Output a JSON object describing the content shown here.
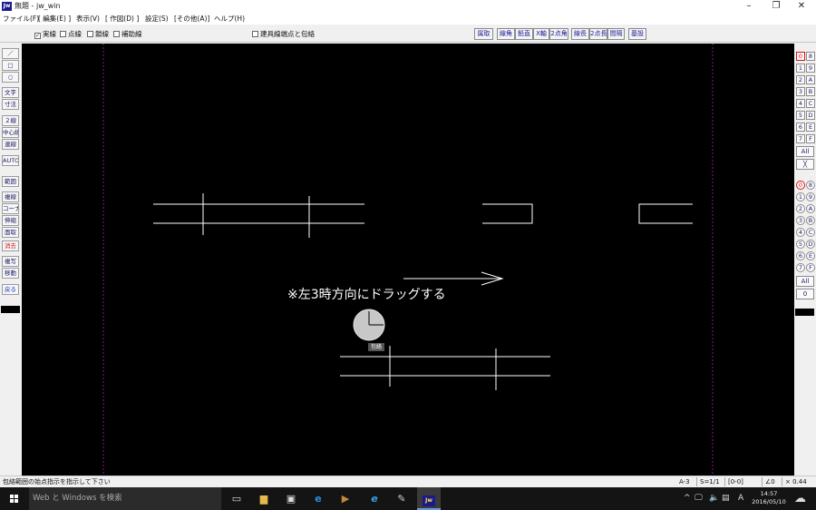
{
  "window": {
    "app_icon_label": "Jw",
    "title": "無題 - jw_win",
    "minimize": "–",
    "maximize": "❐",
    "close": "✕"
  },
  "menu": {
    "file": "ファイル(F)",
    "edit": "[ 編集(E) ]",
    "view": "表示(V)",
    "draw": "[ 作図(D) ]",
    "settings": "設定(S)",
    "other": "[その他(A)]",
    "help": "ヘルプ(H)"
  },
  "control_bar": {
    "solid_line": "実線",
    "solid_line_checked": "✓",
    "dotted_line": "点線",
    "chain_line": "鎖線",
    "aux_line": "補助線",
    "fixture_endpoint": "建具線端点と包絡"
  },
  "toolbar_right": {
    "b1": "属取",
    "b2": "線角",
    "b3": "鉛直",
    "b4": "X軸",
    "b5": "2点角",
    "b6": "線長",
    "b7": "2点長",
    "b8": "間隔",
    "b9": "基設"
  },
  "left_tools": {
    "line": "／",
    "rect": "□",
    "circle": "○",
    "text": "文字",
    "dimension": "寸法",
    "double_line": "２線",
    "center_line": "中心線",
    "continuous_line": "連線",
    "auto": "AUTO",
    "range": "範囲",
    "copy_line": "複線",
    "corner": "コーナー",
    "extend": "伸縮",
    "chamfer": "面取",
    "erase": "消去",
    "duplicate": "複写",
    "move": "移動",
    "undo": "戻る"
  },
  "right_palette": {
    "layer_group_row1": [
      "0",
      "8"
    ],
    "layer_group_row2": [
      "1",
      "9"
    ],
    "layer_group_row3": [
      "2",
      "A"
    ],
    "layer_group_row4": [
      "3",
      "B"
    ],
    "layer_group_row5": [
      "4",
      "C"
    ],
    "layer_group_row6": [
      "5",
      "D"
    ],
    "layer_group_row7": [
      "6",
      "E"
    ],
    "layer_group_row8": [
      "7",
      "F"
    ],
    "all_top": "All",
    "cross_top": "╳",
    "layer_row1": [
      "0",
      "8"
    ],
    "layer_row2": [
      "1",
      "9"
    ],
    "layer_row3": [
      "2",
      "A"
    ],
    "layer_row4": [
      "3",
      "B"
    ],
    "layer_row5": [
      "4",
      "C"
    ],
    "layer_row6": [
      "5",
      "D"
    ],
    "layer_row7": [
      "6",
      "E"
    ],
    "layer_row8": [
      "7",
      "F"
    ],
    "all_bottom": "All",
    "zero_bottom": "0"
  },
  "canvas": {
    "instruction": "※左3時方向にドラッグする",
    "cursor_label": "包絡",
    "line_color": "#ffffff",
    "guide_color": "#8a1a8a"
  },
  "status_bar": {
    "message": "包絡範囲の始点指示を指示して下さい",
    "paper": "A-3",
    "scale": "S=1/1",
    "layer": "[0-0]",
    "angle": "∠0",
    "zoom": "× 0.44"
  },
  "taskbar": {
    "search_placeholder": "Web と Windows を検索",
    "ime": "A",
    "time": "14:57",
    "date": "2016/05/10"
  }
}
